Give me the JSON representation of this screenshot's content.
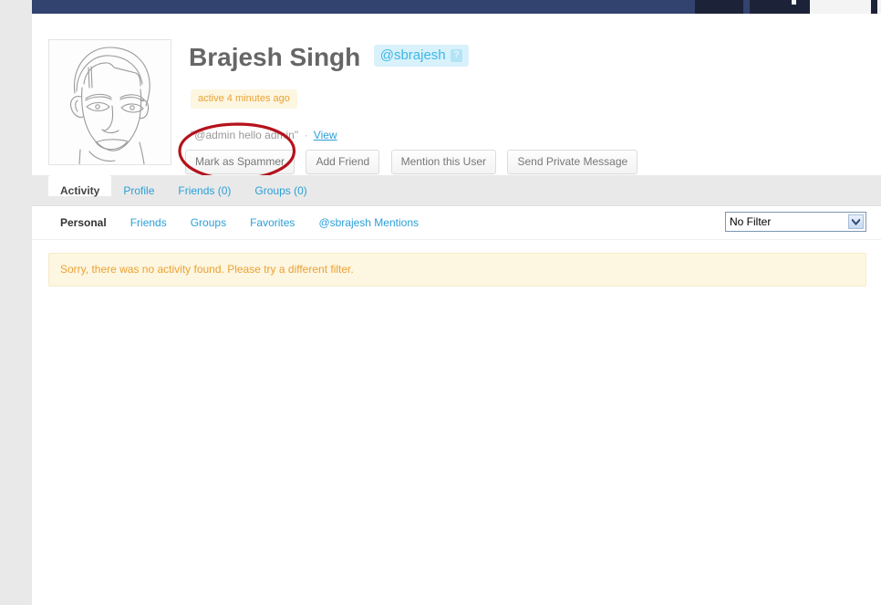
{
  "admin_bar": {
    "present": true,
    "bg_color": "#32436f",
    "segment_color": "#1c2237"
  },
  "profile": {
    "avatar_alt": "member-avatar-line-drawing-face",
    "member_name": "Brajesh Singh",
    "user_nicename": "@sbrajesh",
    "nicename_help_label": "?",
    "activity_badge": "active 4 minutes ago",
    "latest_update": {
      "quote": "\"@admin hello admin\"",
      "separator": "·",
      "view_label": "View"
    },
    "buttons": [
      {
        "id": "mark-as-spammer",
        "label": "Mark as Spammer",
        "annotated": true
      },
      {
        "id": "add-friend",
        "label": "Add Friend",
        "annotated": false
      },
      {
        "id": "mention-this-user",
        "label": "Mention this User",
        "annotated": false
      },
      {
        "id": "send-private-message",
        "label": "Send Private Message",
        "annotated": false
      }
    ]
  },
  "annotation": {
    "type": "ellipse",
    "color": "#b5121b",
    "target": "mark-as-spammer"
  },
  "item_nav": {
    "tabs": [
      {
        "label": "Activity",
        "current": true
      },
      {
        "label": "Profile",
        "current": false
      },
      {
        "label": "Friends (0)",
        "current": false
      },
      {
        "label": "Groups (0)",
        "current": false
      }
    ]
  },
  "subnav": {
    "items": [
      {
        "label": "Personal",
        "current": true
      },
      {
        "label": "Friends",
        "current": false
      },
      {
        "label": "Groups",
        "current": false
      },
      {
        "label": "Favorites",
        "current": false
      },
      {
        "label": "@sbrajesh Mentions",
        "current": false
      }
    ],
    "filter": {
      "selected": "No Filter",
      "icon": "chevron-down-icon"
    }
  },
  "content": {
    "notice": "Sorry, there was no activity found. Please try a different filter."
  },
  "colors": {
    "link": "#2a9fd8",
    "notice_bg": "#fdf6e1",
    "notice_text": "#eba233",
    "nicename_bg": "#d9f1fb",
    "page_bg": "#e9e9e9",
    "annotation": "#b5121b"
  }
}
